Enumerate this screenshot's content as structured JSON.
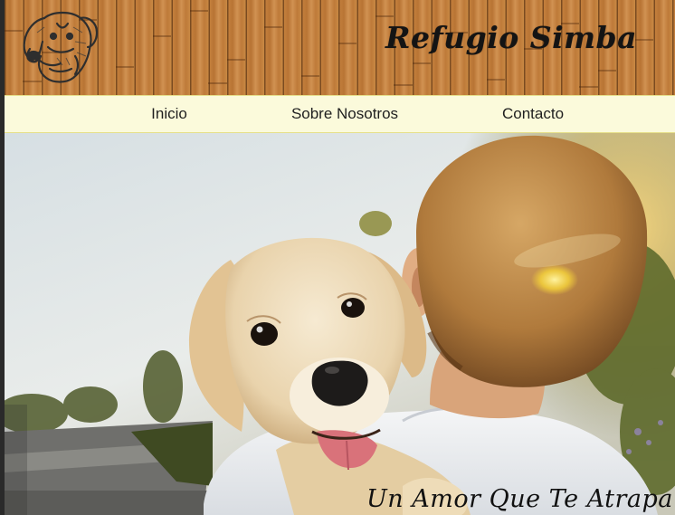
{
  "site": {
    "title": "Refugio Simba"
  },
  "nav": {
    "items": [
      {
        "label": "Inicio"
      },
      {
        "label": "Sobre Nosotros"
      },
      {
        "label": "Contacto"
      }
    ]
  },
  "hero": {
    "tagline": "Un Amor Que Te Atrapa",
    "image_description_icon": "boy-hugging-puppy-photo"
  },
  "colors": {
    "wood": "#c3803e",
    "nav_background": "#fbfadb",
    "nav_border": "#e6e08a",
    "title_text": "#141414"
  },
  "icons": {
    "logo": "dog-head-logo-icon"
  }
}
